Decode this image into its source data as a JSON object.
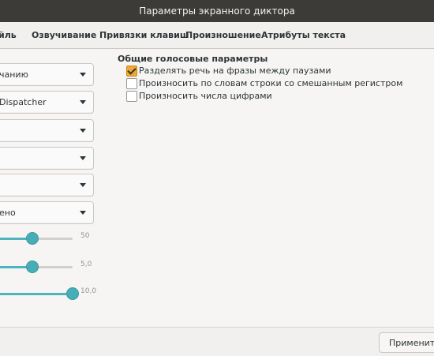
{
  "window": {
    "title": "Параметры экранного диктора"
  },
  "tabs": [
    {
      "label": "йль"
    },
    {
      "label": "Озвучивание"
    },
    {
      "label": "Привязки клавиш"
    },
    {
      "label": "Произношение"
    },
    {
      "label": "Атрибуты текста"
    }
  ],
  "left": {
    "combos": [
      {
        "value": "чанию"
      },
      {
        "value": "Dispatcher"
      },
      {
        "value": ""
      },
      {
        "value": ""
      },
      {
        "value": ""
      },
      {
        "value": "ено"
      }
    ],
    "sliders": [
      {
        "value_label": "50",
        "fraction": 0.5
      },
      {
        "value_label": "5,0",
        "fraction": 0.5
      },
      {
        "value_label": "10,0",
        "fraction": 1.0
      }
    ]
  },
  "voice_settings": {
    "title": "Общие голосовые параметры",
    "options": [
      {
        "label": "Разделять речь на фразы между паузами",
        "checked": true
      },
      {
        "label": "Произносить по словам строки со смешанным регистром",
        "checked": false
      },
      {
        "label": "Произносить числа цифрами",
        "checked": false
      }
    ]
  },
  "buttons": {
    "apply": "Применить"
  }
}
